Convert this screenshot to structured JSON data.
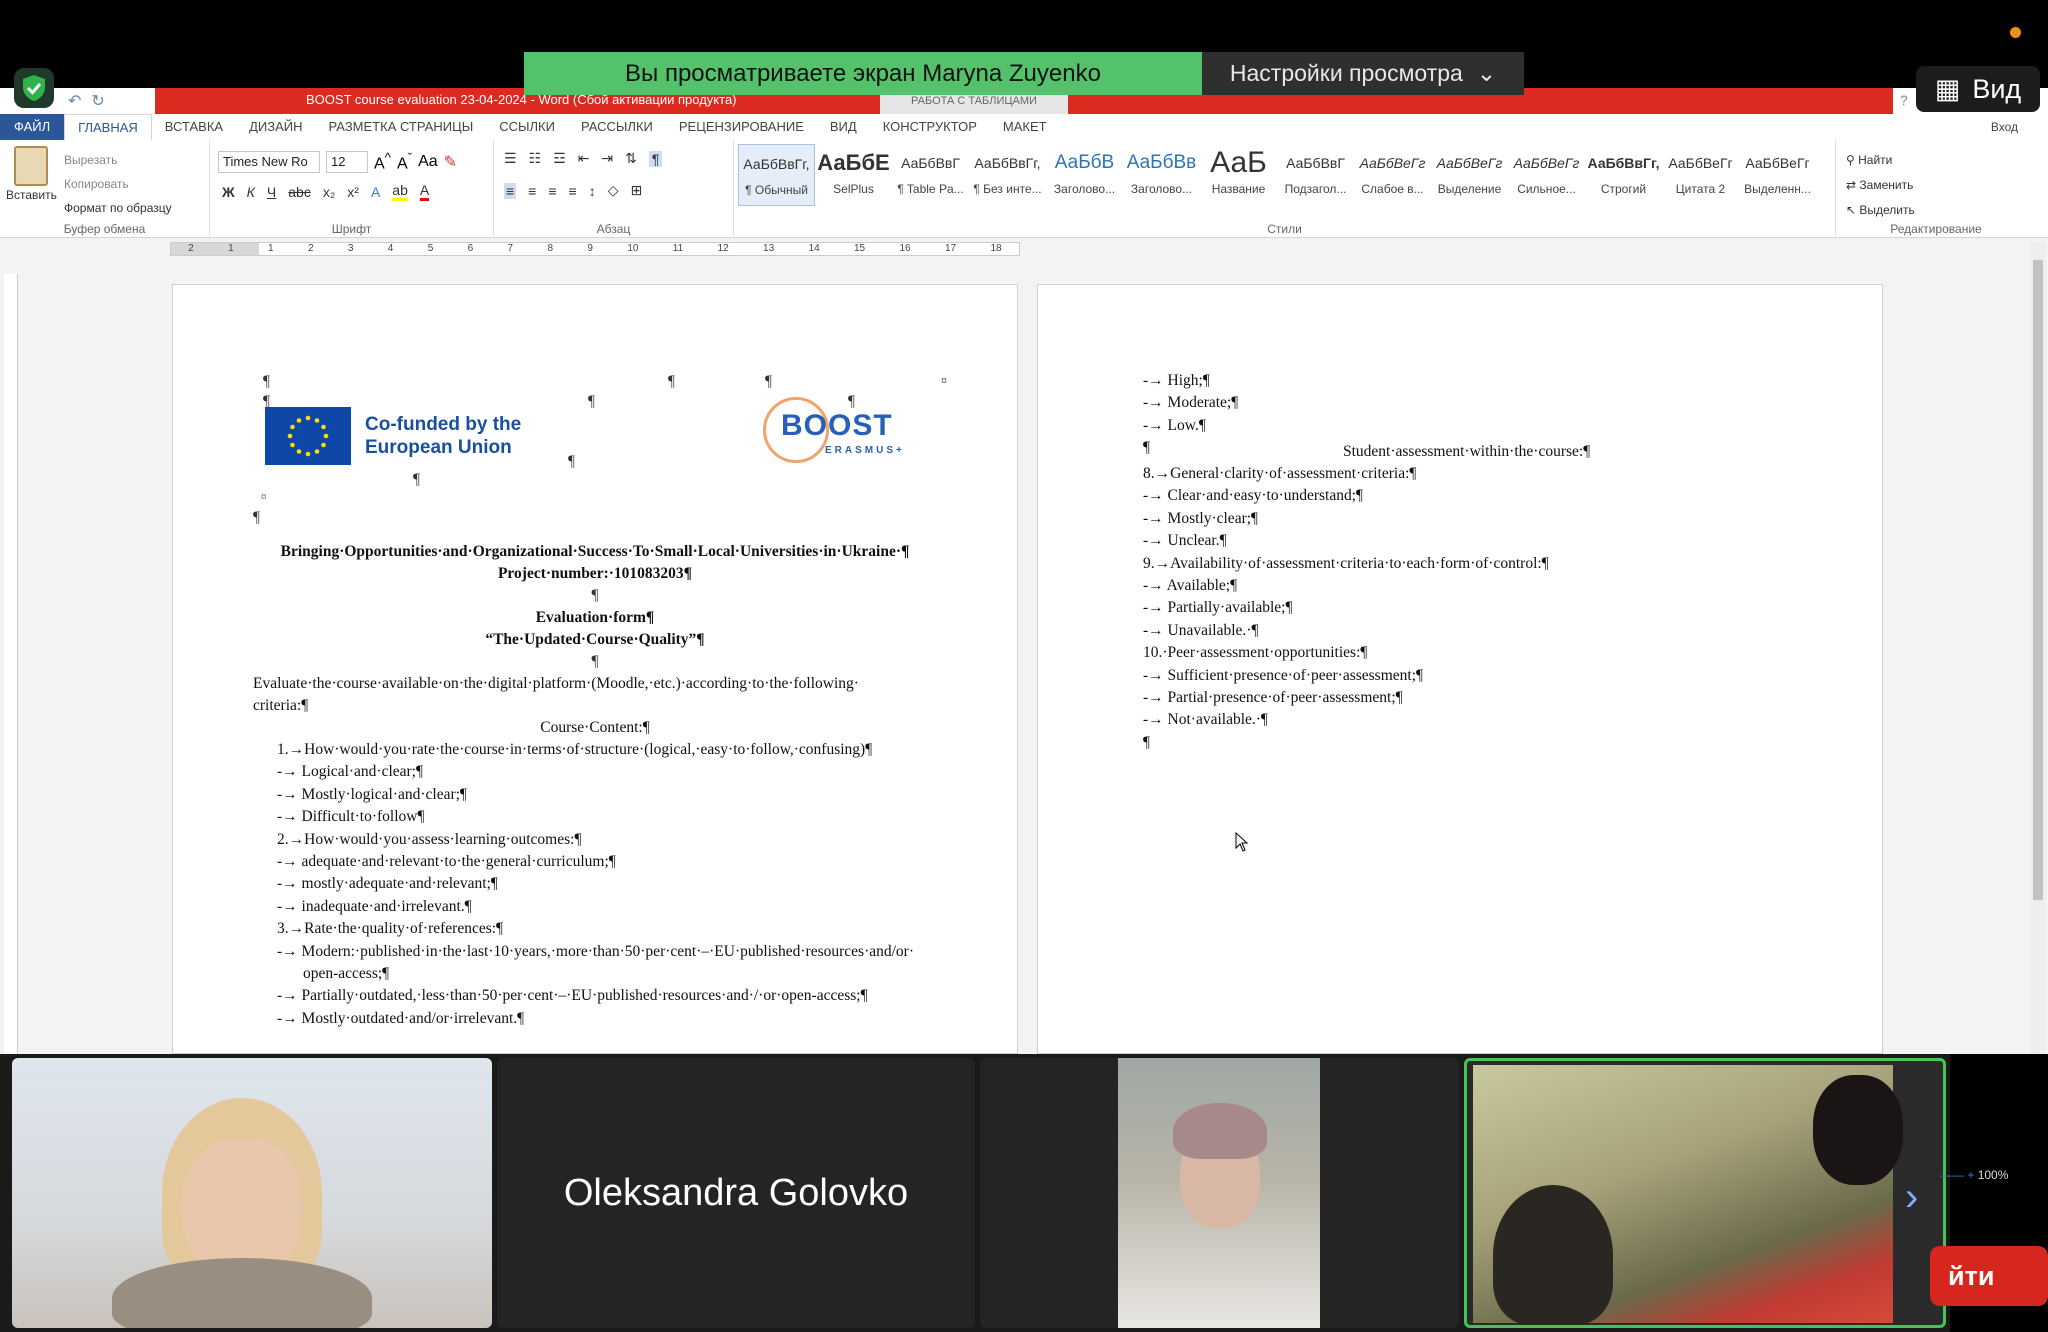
{
  "zoom": {
    "share_banner": "Вы просматриваете экран Maryna Zuyenko",
    "view_settings": "Настройки просмотра",
    "view_button": "Вид",
    "leave_button": "йти",
    "participant_name": "Oleksandra Golovko"
  },
  "word": {
    "title": "BOOST course evaluation 23-04-2024 - Word (Сбой активации продукта)",
    "table_tools": "РАБОТА С ТАБЛИЦАМИ",
    "tabs": [
      "ФАЙЛ",
      "ГЛАВНАЯ",
      "ВСТАВКА",
      "ДИЗАЙН",
      "РАЗМЕТКА СТРАНИЦЫ",
      "ССЫЛКИ",
      "РАССЫЛКИ",
      "РЕЦЕНЗИРОВАНИЕ",
      "ВИД",
      "КОНСТРУКТОР",
      "МАКЕТ"
    ],
    "login": "Вход",
    "clipboard": {
      "paste": "Вставить",
      "cut": "Вырезать",
      "copy": "Копировать",
      "format_painter": "Формат по образцу",
      "label": "Буфер обмена"
    },
    "font": {
      "name": "Times New Ro",
      "size": "12",
      "label": "Шрифт"
    },
    "paragraph_label": "Абзац",
    "styles_label": "Стили",
    "editing": {
      "find": "Найти",
      "replace": "Заменить",
      "select": "Выделить",
      "label": "Редактирование"
    },
    "styles": [
      {
        "preview": "АаБбВвГг,",
        "name": "¶ Обычный"
      },
      {
        "preview": "АаБбЕ",
        "name": "SelPlus"
      },
      {
        "preview": "АаБбВвГ",
        "name": "¶ Table Pa..."
      },
      {
        "preview": "АаБбВвГг,",
        "name": "¶ Без инте..."
      },
      {
        "preview": "АаБбВ",
        "name": "Заголово..."
      },
      {
        "preview": "АаБбВв",
        "name": "Заголово..."
      },
      {
        "preview": "АаБ",
        "name": "Название"
      },
      {
        "preview": "АаБбВвГ",
        "name": "Подзагол..."
      },
      {
        "preview": "АаБбВеГг",
        "name": "Слабое в..."
      },
      {
        "preview": "АаБбВеГг",
        "name": "Выделение"
      },
      {
        "preview": "АаБбВеГг",
        "name": "Сильное..."
      },
      {
        "preview": "АаБбВвГг,",
        "name": "Строгий"
      },
      {
        "preview": "АаБбВеГг",
        "name": "Цитата 2"
      },
      {
        "preview": "АаБбВеГг",
        "name": "Выделенн..."
      }
    ],
    "zoom_level": "100%",
    "ruler_numbers": [
      "2",
      "1",
      "1",
      "2",
      "3",
      "4",
      "5",
      "6",
      "7",
      "8",
      "9",
      "10",
      "11",
      "12",
      "13",
      "14",
      "15",
      "16",
      "17",
      "18"
    ]
  },
  "page1": {
    "eu_logo_text": "Co-funded by the European Union",
    "boost_text": "BOOST",
    "erasmus_text": "ERASMUS+",
    "title": "Bringing·Opportunities·and·Organizational·Success·To·Small·Local·Universities·in·Ukraine·¶",
    "project": "Project·number:·101083203¶",
    "form_title": "Evaluation·form¶",
    "form_subtitle": "“The·Updated·Course·Quality”¶",
    "intro1": "Evaluate·the·course·available·on·the·digital·platform·(Moodle,·etc.)·according·to·the·following·",
    "intro2": "criteria:¶",
    "section": "Course·Content:¶",
    "lines": [
      "1.→How·would·you·rate·the·course·in·terms·of·structure·(logical,·easy·to·follow,·confusing)¶",
      "-→ Logical·and·clear;¶",
      "-→ Mostly·logical·and·clear;¶",
      "-→ Difficult·to·follow¶",
      "2.→How·would·you·assess·learning·outcomes:¶",
      "-→ adequate·and·relevant·to·the·general·curriculum;¶",
      "-→ mostly·adequate·and·relevant;¶",
      "-→ inadequate·and·irrelevant.¶",
      "3.→Rate·the·quality·of·references:¶",
      "-→ Modern:·published·in·the·last·10·years,·more·than·50·per·cent·–·EU·published·resources·and/or·",
      "open-access;¶",
      "-→ Partially·outdated,·less·than·50·per·cent·–·EU·published·resources·and·/·or·open-access;¶",
      "-→ Mostly·outdated·and/or·irrelevant.¶"
    ]
  },
  "page2": {
    "lines_a": [
      "-→ High;¶",
      "-→ Moderate;¶",
      "-→ Low.¶",
      "¶"
    ],
    "section": "Student·assessment·within·the·course:¶",
    "lines_b": [
      "8.→General·clarity·of·assessment·criteria:¶",
      "-→ Clear·and·easy·to·understand;¶",
      "-→ Mostly·clear;¶",
      "-→ Unclear.¶",
      "9.→Availability·of·assessment·criteria·to·each·form·of·control:¶",
      "-→ Available;¶",
      "-→ Partially·available;¶",
      "-→ Unavailable.·¶",
      "10.·Peer·assessment·opportunities:¶",
      "-→ Sufficient·presence·of·peer·assessment;¶",
      "-→ Partial·presence·of·peer·assessment;¶",
      "-→ Not·available.·¶",
      "¶"
    ]
  }
}
